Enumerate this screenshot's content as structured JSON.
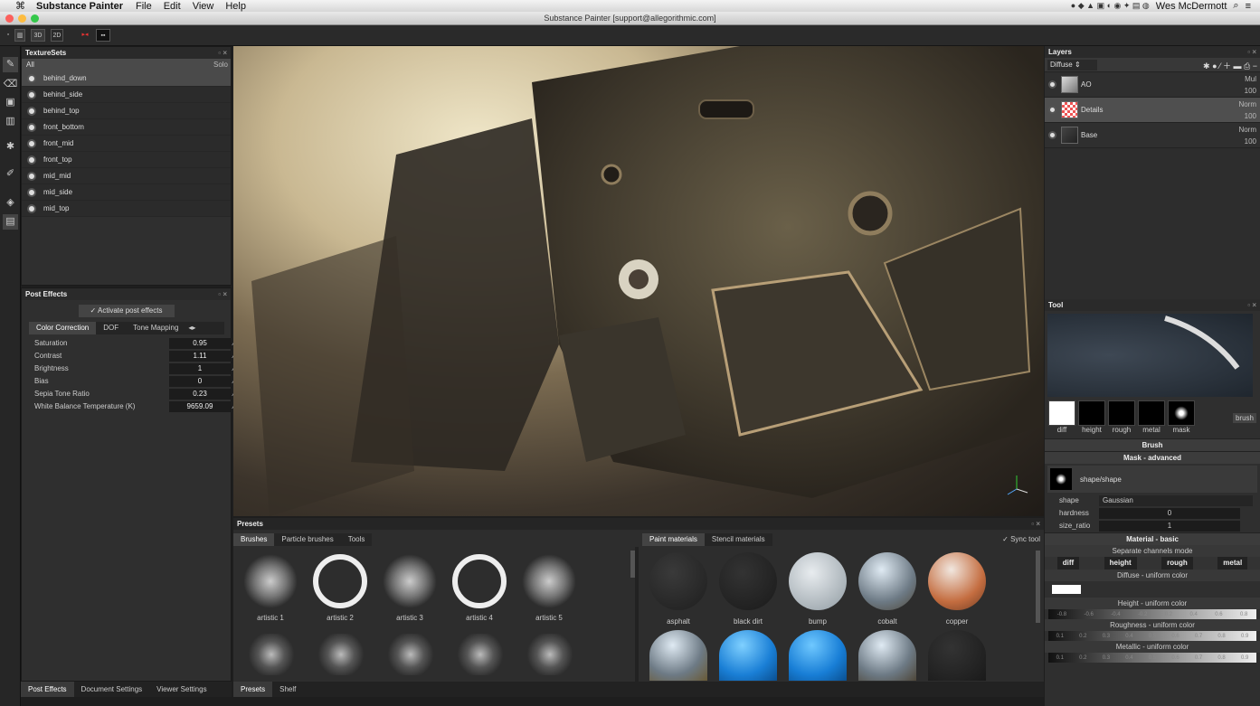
{
  "menubar": {
    "app": "Substance Painter",
    "items": [
      "File",
      "Edit",
      "View",
      "Help"
    ],
    "user": "Wes McDermott"
  },
  "window_title": "Substance Painter [support@allegorithmic.com]",
  "toolbar": {
    "b1": "3D",
    "b2": "2D",
    "b3": "▸◂",
    "b4": "▪▪"
  },
  "texturesets": {
    "title": "TextureSets",
    "all_label": "All",
    "solo_label": "Solo",
    "items": [
      "behind_down",
      "behind_side",
      "behind_top",
      "front_bottom",
      "front_mid",
      "front_top",
      "mid_mid",
      "mid_side",
      "mid_top"
    ]
  },
  "post_effects": {
    "title": "Post Effects",
    "activate_label": "Activate post effects",
    "tabs": [
      "Color Correction",
      "DOF",
      "Tone Mapping"
    ],
    "params": [
      {
        "label": "Saturation",
        "value": "0.95"
      },
      {
        "label": "Contrast",
        "value": "1.11"
      },
      {
        "label": "Brightness",
        "value": "1"
      },
      {
        "label": "Bias",
        "value": "0"
      },
      {
        "label": "Sepia Tone Ratio",
        "value": "0.23"
      },
      {
        "label": "White Balance Temperature (K)",
        "value": "9659.09"
      }
    ],
    "bottom_tabs": [
      "Post Effects",
      "Document Settings",
      "Viewer Settings"
    ]
  },
  "presets": {
    "title": "Presets",
    "left_tabs": [
      "Brushes",
      "Particle brushes",
      "Tools"
    ],
    "right_tabs": [
      "Paint materials",
      "Stencil materials"
    ],
    "sync_label": "Sync tool",
    "brushes": [
      "artistic 1",
      "artistic 2",
      "artistic 3",
      "artistic 4",
      "artistic 5"
    ],
    "materials": [
      "asphalt",
      "black dirt",
      "bump",
      "cobalt",
      "copper"
    ],
    "bottom_tabs": [
      "Presets",
      "Shelf"
    ]
  },
  "layers": {
    "title": "Layers",
    "channel": "Diffuse",
    "items": [
      {
        "name": "AO",
        "blend": "Mul",
        "opacity": "100"
      },
      {
        "name": "Details",
        "blend": "Norm",
        "opacity": "100"
      },
      {
        "name": "Base",
        "blend": "Norm",
        "opacity": "100"
      }
    ]
  },
  "tool": {
    "title": "Tool",
    "channels": [
      "diff",
      "height",
      "rough",
      "metal",
      "mask"
    ],
    "brush_btn": "brush",
    "brush_section": "Brush",
    "mask_section": "Mask - advanced",
    "shape_name": "shape/shape",
    "shape_label": "shape",
    "shape_value": "Gaussian",
    "hardness_label": "hardness",
    "hardness_value": "0",
    "size_ratio_label": "size_ratio",
    "size_ratio_value": "1",
    "material_section": "Material - basic",
    "separate_label": "Separate channels mode",
    "sep_buttons": [
      "diff",
      "height",
      "rough",
      "metal"
    ],
    "diffuse_label": "Diffuse - uniform color",
    "height_label": "Height - uniform color",
    "roughness_label": "Roughness - uniform color",
    "metallic_label": "Metallic - uniform color",
    "slider_ticks": [
      "0.1",
      "0.2",
      "0.3",
      "0.4",
      "0.5",
      "0.6",
      "0.7",
      "0.8",
      "0.9"
    ],
    "height_ticks": [
      "-0.8",
      "-0.6",
      "-0.4",
      "-0.2",
      "0.2",
      "0.4",
      "0.6",
      "0.8"
    ]
  }
}
